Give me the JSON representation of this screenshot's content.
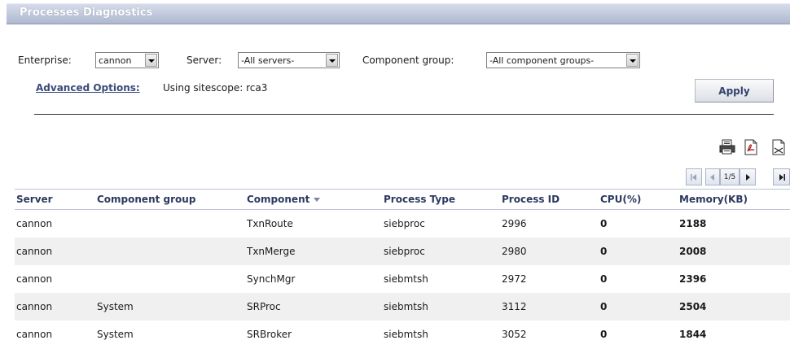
{
  "title": "Processes Diagnostics",
  "filters": {
    "enterprise_label": "Enterprise:",
    "enterprise_value": "cannon",
    "server_label": "Server:",
    "server_value": "-All servers-",
    "component_group_label": "Component group:",
    "component_group_value": "-All component groups-"
  },
  "advanced": {
    "link_label": "Advanced Options:",
    "info_text": "Using sitescope: rca3"
  },
  "apply_label": "Apply",
  "toolbar_icons": [
    "print-icon",
    "pdf-export-icon",
    "excel-export-icon"
  ],
  "pagination": {
    "page_text": "1/5"
  },
  "table": {
    "columns": [
      "Server",
      "Component group",
      "Component",
      "Process Type",
      "Process ID",
      "CPU(%)",
      "Memory(KB)"
    ],
    "sorted_column": "Component",
    "rows": [
      {
        "server": "cannon",
        "group": "",
        "component": "TxnRoute",
        "type": "siebproc",
        "pid": "2996",
        "cpu": "0",
        "memory": "2188"
      },
      {
        "server": "cannon",
        "group": "",
        "component": "TxnMerge",
        "type": "siebproc",
        "pid": "2980",
        "cpu": "0",
        "memory": "2008"
      },
      {
        "server": "cannon",
        "group": "",
        "component": "SynchMgr",
        "type": "siebmtsh",
        "pid": "2972",
        "cpu": "0",
        "memory": "2396"
      },
      {
        "server": "cannon",
        "group": "System",
        "component": "SRProc",
        "type": "siebmtsh",
        "pid": "3112",
        "cpu": "0",
        "memory": "2504"
      },
      {
        "server": "cannon",
        "group": "System",
        "component": "SRBroker",
        "type": "siebmtsh",
        "pid": "3052",
        "cpu": "0",
        "memory": "1844"
      }
    ]
  },
  "colors": {
    "title_bar": "#b4bdd2",
    "header_text": "#2c3a60",
    "value_green": "#1f8a1f",
    "row_alt": "#f0f0f0"
  }
}
